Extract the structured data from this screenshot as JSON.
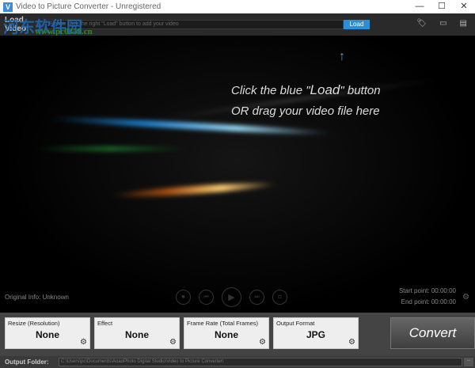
{
  "window": {
    "title": "Video to Picture Converter - Unregistered",
    "minimize": "—",
    "maximize": "☐",
    "close": "✕",
    "icon": "V"
  },
  "watermark": {
    "text": "河东软件园",
    "url": "www.pc0359.cn"
  },
  "load": {
    "label": "Load Video:",
    "placeholder": "Please click the right \"Load\" button to add your video",
    "button": "Load"
  },
  "top_icons": [
    "tag-icon",
    "comment-icon",
    "document-icon"
  ],
  "video": {
    "hint_line1_pre": "Click the blue \"",
    "hint_load": "Load",
    "hint_line1_post": "\" button",
    "hint_line2": "OR drag your video file here"
  },
  "info": "Original Info: Unknown",
  "points": {
    "start": "Start point: 00:00:00",
    "end": "End point: 00:00:00"
  },
  "settings": [
    {
      "label": "Resize (Resolution)",
      "value": "None"
    },
    {
      "label": "Effect",
      "value": "None"
    },
    {
      "label": "Frame Rate (Total Frames)",
      "value": "None"
    },
    {
      "label": "Output Format",
      "value": "JPG"
    }
  ],
  "convert": "Convert",
  "output": {
    "label": "Output Folder:",
    "path": "C:\\Users\\pc\\Documents\\AoaoPhoto Digital Studio\\Video to Picture Converter\\",
    "browse": "..."
  }
}
